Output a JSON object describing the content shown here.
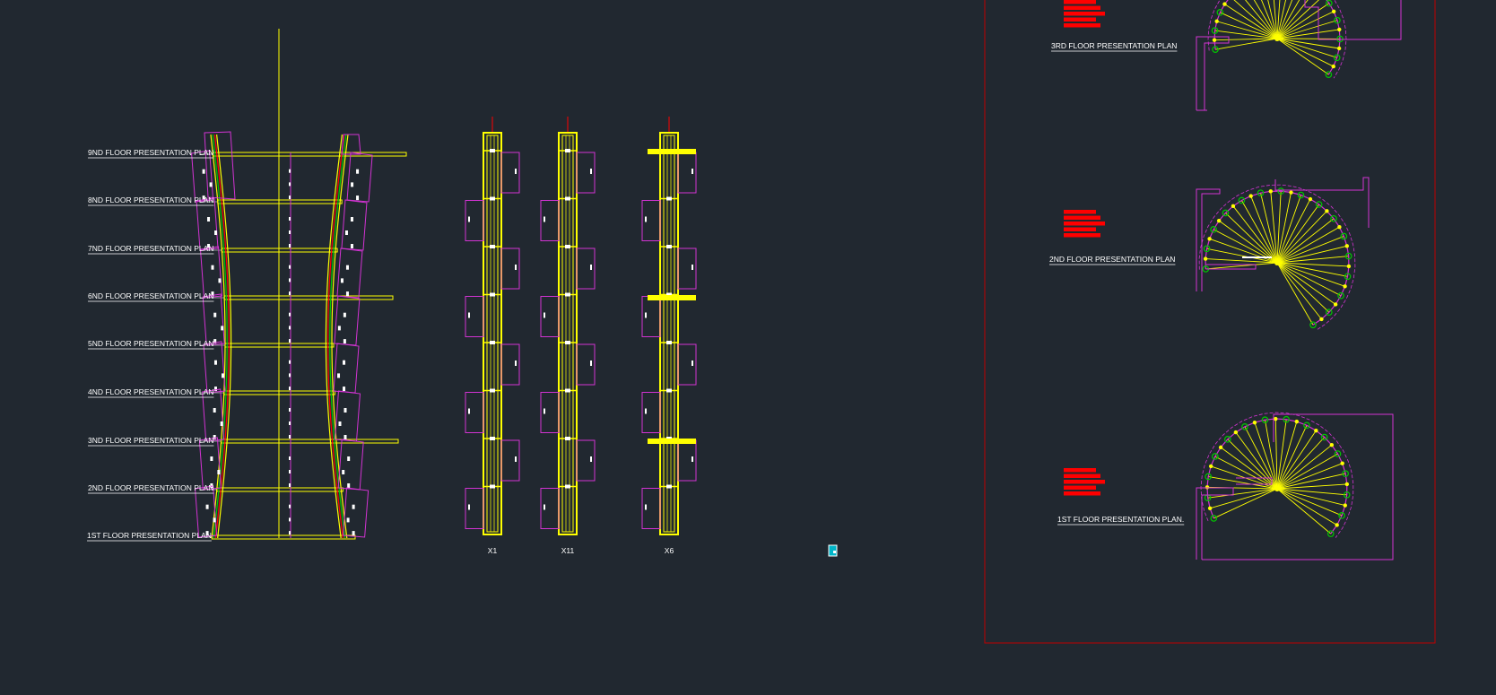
{
  "colors": {
    "background": "#212830",
    "yellow": "#ffff00",
    "magenta": "#d233d2",
    "red": "#ff0000",
    "green": "#00c800",
    "white": "#ffffff",
    "cyan": "#00b5c8"
  },
  "elevation": {
    "floor_labels": [
      "9ND FLOOR PRESENTATION PLAN",
      "8ND FLOOR PRESENTATION PLAN",
      "7ND FLOOR PRESENTATION PLAN",
      "6ND FLOOR PRESENTATION PLAN",
      "5ND FLOOR PRESENTATION PLAN",
      "4ND FLOOR PRESENTATION PLAN",
      "3ND FLOOR PRESENTATION PLAN",
      "2ND FLOOR PRESENTATION PLAN",
      "1ST FLOOR PRESENTATION PLAN"
    ]
  },
  "columns": {
    "labels": [
      "X1",
      "X11",
      "X6"
    ]
  },
  "plans": {
    "labels": [
      "3RD FLOOR PRESENTATION PLAN",
      "2ND FLOOR PRESENTATION PLAN",
      "1ST FLOOR PRESENTATION PLAN."
    ]
  },
  "marker_icon": "cursor-marker-icon"
}
